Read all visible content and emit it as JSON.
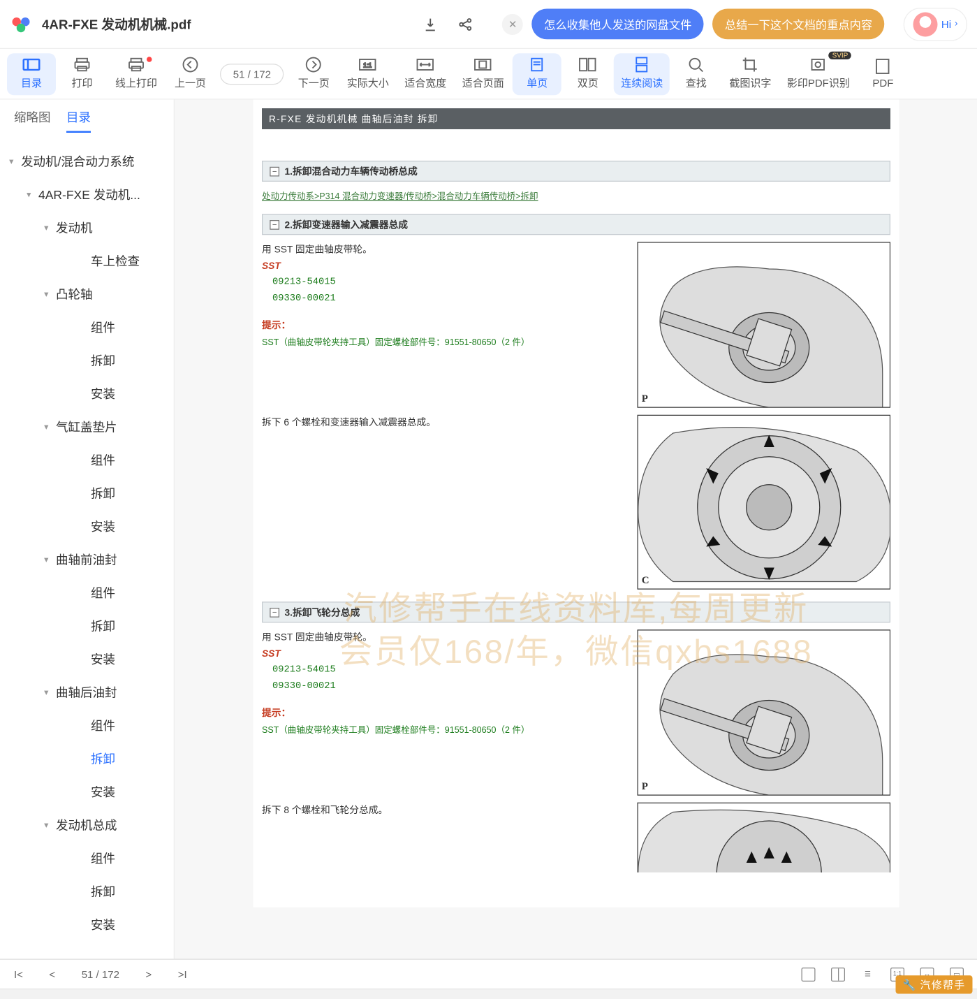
{
  "header": {
    "filename": "4AR-FXE 发动机机械.pdf",
    "hi": "Hi",
    "suggestions": [
      "怎么收集他人发送的网盘文件",
      "总结一下这个文档的重点内容"
    ]
  },
  "toolbar": {
    "items": [
      {
        "label": "目录",
        "active": true,
        "dot": false
      },
      {
        "label": "打印",
        "active": false,
        "dot": false
      },
      {
        "label": "线上打印",
        "active": false,
        "dot": true
      },
      {
        "label": "上一页",
        "active": false,
        "dot": false
      }
    ],
    "page_ind": "51  / 172",
    "items2": [
      {
        "label": "下一页"
      },
      {
        "label": "实际大小"
      },
      {
        "label": "适合宽度"
      },
      {
        "label": "适合页面"
      },
      {
        "label": "单页",
        "active": true
      },
      {
        "label": "双页"
      },
      {
        "label": "连续阅读",
        "active": true
      },
      {
        "label": "查找"
      },
      {
        "label": "截图识字"
      },
      {
        "label": "影印PDF识别",
        "svip": true
      },
      {
        "label": "PDF"
      }
    ]
  },
  "sidebar": {
    "tabs": [
      {
        "label": "缩略图",
        "active": false
      },
      {
        "label": "目录",
        "active": true
      }
    ],
    "tree": [
      {
        "l": 0,
        "arw": "▾",
        "txt": "发动机/混合动力系统"
      },
      {
        "l": 1,
        "arw": "▾",
        "txt": "4AR-FXE 发动机..."
      },
      {
        "l": 2,
        "arw": "▾",
        "txt": "发动机"
      },
      {
        "l": 3,
        "arw": "",
        "txt": "车上检查"
      },
      {
        "l": 2,
        "arw": "▾",
        "txt": "凸轮轴"
      },
      {
        "l": 3,
        "arw": "",
        "txt": "组件"
      },
      {
        "l": 3,
        "arw": "",
        "txt": "拆卸"
      },
      {
        "l": 3,
        "arw": "",
        "txt": "安装"
      },
      {
        "l": 2,
        "arw": "▾",
        "txt": "气缸盖垫片"
      },
      {
        "l": 3,
        "arw": "",
        "txt": "组件"
      },
      {
        "l": 3,
        "arw": "",
        "txt": "拆卸"
      },
      {
        "l": 3,
        "arw": "",
        "txt": "安装"
      },
      {
        "l": 2,
        "arw": "▾",
        "txt": "曲轴前油封"
      },
      {
        "l": 3,
        "arw": "",
        "txt": "组件"
      },
      {
        "l": 3,
        "arw": "",
        "txt": "拆卸"
      },
      {
        "l": 3,
        "arw": "",
        "txt": "安装"
      },
      {
        "l": 2,
        "arw": "▾",
        "txt": "曲轴后油封"
      },
      {
        "l": 3,
        "arw": "",
        "txt": "组件"
      },
      {
        "l": 3,
        "arw": "",
        "txt": "拆卸",
        "sel": true
      },
      {
        "l": 3,
        "arw": "",
        "txt": "安装"
      },
      {
        "l": 2,
        "arw": "▾",
        "txt": "发动机总成"
      },
      {
        "l": 3,
        "arw": "",
        "txt": "组件"
      },
      {
        "l": 3,
        "arw": "",
        "txt": "拆卸"
      },
      {
        "l": 3,
        "arw": "",
        "txt": "安装"
      }
    ]
  },
  "doc": {
    "hdr": "R-FXE  发动机机械   曲轴后油封   拆卸",
    "sub": "",
    "steps": [
      {
        "no": "1.",
        "title": "拆卸混合动力车辆传动桥总成",
        "crumb": "处动力传动系>P314 混合动力变速器/传动桥>混合动力车辆传动桥>拆卸"
      },
      {
        "no": "2.",
        "title": "拆卸变速器输入减震器总成"
      },
      {
        "no": "3.",
        "title": "拆卸飞轮分总成"
      }
    ],
    "text1": "用 SST 固定曲轴皮带轮。",
    "sst": "SST",
    "codes": [
      "09213-54015",
      "09330-00021"
    ],
    "hint": "提示：",
    "hint_body": "SST（曲轴皮带轮夹持工具）固定螺栓部件号：91551-80650（2 件）",
    "text2": "拆下 6 个螺栓和变速器输入减震器总成。",
    "text3": "用 SST 固定曲轴皮带轮。",
    "text4": "拆下 8 个螺栓和飞轮分总成。",
    "tags": {
      "p": "P",
      "c": "C"
    },
    "watermark1": "汽修帮手在线资料库,每周更新",
    "watermark2": "会员仅168/年，微信qxbs1688"
  },
  "bottom": {
    "page": "51  / 172",
    "brand": "汽修帮手"
  }
}
